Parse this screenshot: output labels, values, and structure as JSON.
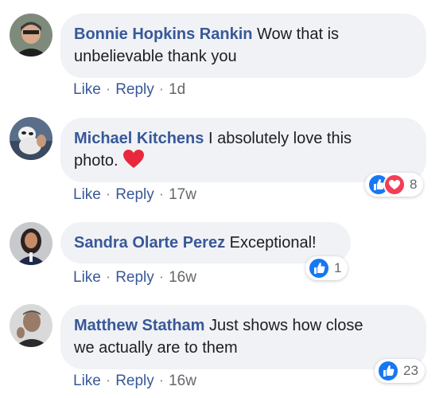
{
  "comments": [
    {
      "author": "Bonnie Hopkins Rankin",
      "text_lines": [
        "Wow that is",
        "unbelievable thank you"
      ],
      "like_label": "Like",
      "reply_label": "Reply",
      "time": "1d",
      "reactions": null
    },
    {
      "author": "Michael Kitchens",
      "text_lines": [
        "I absolutely love this",
        "photo."
      ],
      "like_label": "Like",
      "reply_label": "Reply",
      "time": "17w",
      "reactions": {
        "types": [
          "like-icon",
          "love-icon"
        ],
        "count": "8"
      },
      "emoji": "red-heart-icon"
    },
    {
      "author": "Sandra Olarte Perez",
      "text_lines": [
        "Exceptional!"
      ],
      "like_label": "Like",
      "reply_label": "Reply",
      "time": "16w",
      "reactions": {
        "types": [
          "like-icon"
        ],
        "count": "1"
      }
    },
    {
      "author": "Matthew Statham",
      "text_lines": [
        "Just shows how close",
        "we actually are to them"
      ],
      "like_label": "Like",
      "reply_label": "Reply",
      "time": "16w",
      "reactions": {
        "types": [
          "like-icon"
        ],
        "count": "23"
      }
    }
  ],
  "separator": "·",
  "colors": {
    "author": "#385898",
    "bubble": "#f0f2f5",
    "like_blue": "#1877f2",
    "love_red": "#f33e58"
  }
}
